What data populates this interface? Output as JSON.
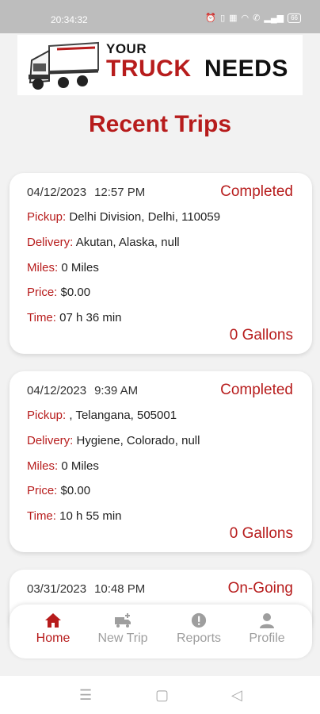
{
  "status_bar": {
    "time": "20:34:32",
    "battery": "66"
  },
  "logo": {
    "word_your": "YOUR",
    "word_truck": "TRUCK",
    "word_needs": "NEEDS"
  },
  "page": {
    "title": "Recent Trips"
  },
  "labels": {
    "pickup": "Pickup:",
    "delivery": "Delivery:",
    "miles": "Miles:",
    "price": "Price:",
    "time": "Time:"
  },
  "trips": [
    {
      "date": "04/12/2023",
      "time": "12:57 PM",
      "status": "Completed",
      "pickup": "Delhi Division, Delhi, 110059",
      "delivery": "Akutan, Alaska, null",
      "miles": "0 Miles",
      "price": "$0.00",
      "duration": "07 h 36 min",
      "gallons": "0 Gallons"
    },
    {
      "date": "04/12/2023",
      "time": "9:39 AM",
      "status": "Completed",
      "pickup": ", Telangana, 505001",
      "delivery": "Hygiene, Colorado, null",
      "miles": "0 Miles",
      "price": "$0.00",
      "duration": "10 h 55 min",
      "gallons": "0 Gallons"
    },
    {
      "date": "03/31/2023",
      "time": "10:48 PM",
      "status": "On-Going"
    }
  ],
  "bottom_nav": [
    {
      "label": "Home",
      "icon": "home-icon",
      "active": true
    },
    {
      "label": "New Trip",
      "icon": "new-trip-icon",
      "active": false
    },
    {
      "label": "Reports",
      "icon": "reports-icon",
      "active": false
    },
    {
      "label": "Profile",
      "icon": "profile-icon",
      "active": false
    }
  ],
  "colors": {
    "accent": "#b71c1c",
    "inactive": "#9e9e9e",
    "background": "#f2f2f2"
  }
}
